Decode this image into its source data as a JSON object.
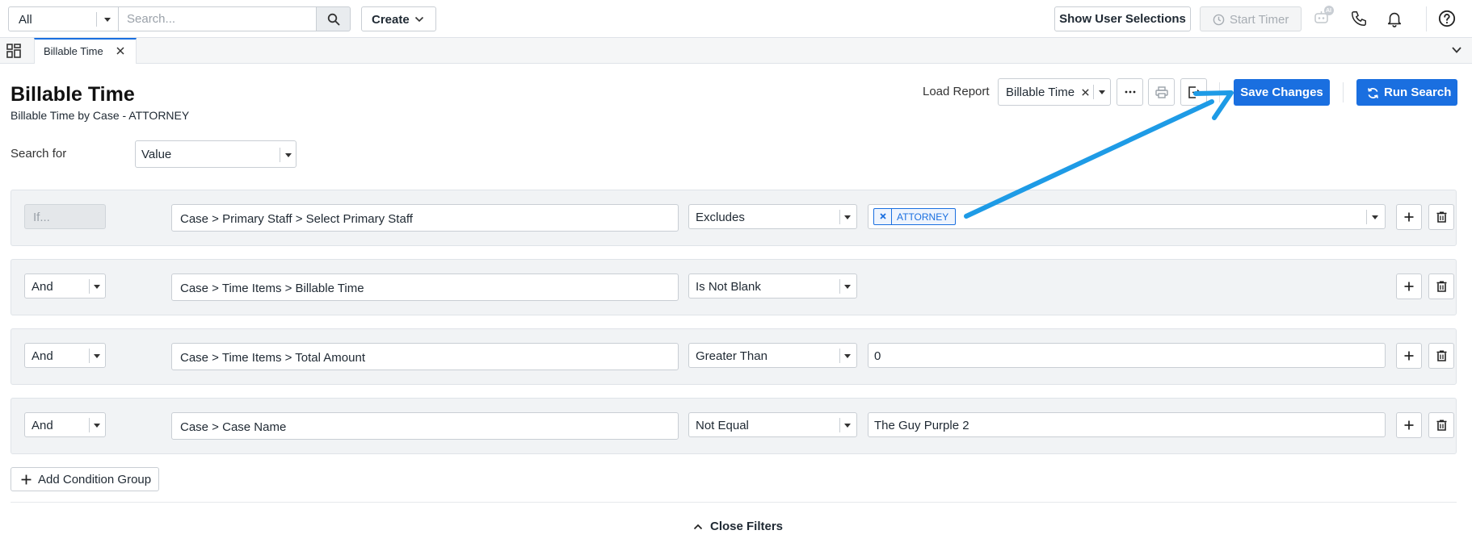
{
  "topbar": {
    "scope_value": "All",
    "search_placeholder": "Search...",
    "create_label": "Create",
    "show_user_selections_label": "Show User Selections",
    "start_timer_label": "Start Timer",
    "ai_badge": "AI",
    "icons": [
      "search-icon",
      "chevron-down-icon",
      "clock-icon",
      "ai-assistant-icon",
      "phone-icon",
      "bell-icon",
      "help-icon"
    ]
  },
  "tabs": {
    "active_tab_label": "Billable Time"
  },
  "header": {
    "title": "Billable Time",
    "subtitle": "Billable Time by Case - ATTORNEY",
    "load_report_label": "Load Report",
    "load_report_value": "Billable Time",
    "save_label": "Save Changes",
    "run_label": "Run Search"
  },
  "search_for": {
    "label": "Search for",
    "value": "Value"
  },
  "conditions": [
    {
      "connector": "If...",
      "field": "Case > Primary Staff > Select Primary Staff",
      "operator": "Excludes",
      "value_chip": "ATTORNEY"
    },
    {
      "connector": "And",
      "field": "Case > Time Items > Billable Time",
      "operator": "Is Not Blank"
    },
    {
      "connector": "And",
      "field": "Case > Time Items > Total Amount",
      "operator": "Greater Than",
      "value": "0"
    },
    {
      "connector": "And",
      "field": "Case > Case Name",
      "operator": "Not Equal",
      "value": "The Guy Purple 2"
    }
  ],
  "footer": {
    "add_condition_group_label": "Add Condition Group",
    "close_filters_label": "Close Filters"
  },
  "colors": {
    "primary": "#1a6fe0",
    "annotation_arrow": "#1e9be6",
    "row_background": "#f1f3f5"
  }
}
